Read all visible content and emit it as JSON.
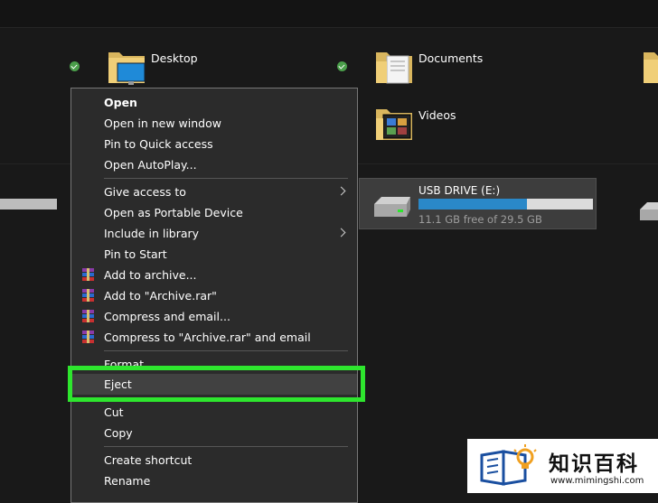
{
  "folders": {
    "desktop": "Desktop",
    "documents": "Documents",
    "videos": "Videos"
  },
  "drive": {
    "name": "USB DRIVE (E:)",
    "free_text": "11.1 GB free of 29.5 GB",
    "used_fraction": 0.62,
    "bar_color": "#2a88c8"
  },
  "context_menu": {
    "open": "Open",
    "open_new_window": "Open in new window",
    "pin_quick_access": "Pin to Quick access",
    "open_autoplay": "Open AutoPlay...",
    "give_access": "Give access to",
    "open_portable": "Open as Portable Device",
    "include_library": "Include in library",
    "pin_start": "Pin to Start",
    "add_archive": "Add to archive...",
    "add_archive_rar": "Add to \"Archive.rar\"",
    "compress_email": "Compress and email...",
    "compress_rar_email": "Compress to \"Archive.rar\" and email",
    "format": "Format...",
    "eject": "Eject",
    "cut": "Cut",
    "copy": "Copy",
    "create_shortcut": "Create shortcut",
    "rename": "Rename"
  },
  "highlight_color": "#2ee62e",
  "watermark": {
    "title": "知识百科",
    "url": "www.mimingshi.com"
  }
}
